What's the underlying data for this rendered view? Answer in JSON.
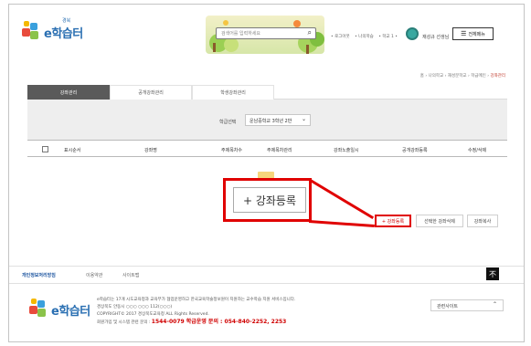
{
  "header": {
    "logo_text": "e학습터",
    "logo_small": "경북",
    "search_placeholder": "검색어를 입력하세요",
    "top_links": [
      "• 로그아웃",
      "• 나의학습",
      "• 학교 1 •"
    ],
    "user_name": "재성규 선생님",
    "all_menu_label": "전체메뉴"
  },
  "breadcrumb": {
    "items": [
      "홈",
      "나의학교",
      "재성분학교",
      "학급메인"
    ],
    "current": "강좌관리"
  },
  "tabs": [
    {
      "label": "강좌관리",
      "active": true
    },
    {
      "label": "공개강좌관리",
      "active": false
    },
    {
      "label": "학생강좌관리",
      "active": false
    }
  ],
  "filter": {
    "label": "학급선택",
    "selected": "운남중학교 3학년 2반"
  },
  "table": {
    "columns": [
      "표시순서",
      "강좌명",
      "주제목차수",
      "주제목차관리",
      "강좌노출일시",
      "공개강좌등록",
      "수정/삭제"
    ]
  },
  "highlight_button_label": "+ 강좌등록",
  "action_buttons": {
    "register": "+ 강좌등록",
    "delete_selected": "선택한 강좌삭제",
    "copy": "강좌복사"
  },
  "footer": {
    "links": [
      "개인정보처리방침",
      "이용약관",
      "사이트맵"
    ],
    "top_button": "不",
    "logo_text": "e학습터",
    "lines": [
      "e학습터는 17개 시도교육청과 교육부가 협업운영하고 한국교육학술정보원이 지원하는 교수학습 지원 서비스입니다.",
      "경상북도 안동시 ○○○ ○○○ 112(○○○)",
      "COPYRIGHT© 2017 경상북도교육청 ALL Rights Reserved."
    ],
    "contact_prefix": "회원가입 및 시스템 관련 문의 : ",
    "contact_1": "1544-0079 학급운영 문의 : ",
    "contact_2": "054-840-2252, 2253",
    "related_label": "관련사이트"
  },
  "colors": {
    "accent_red": "#e00000",
    "tab_active": "#5a5a5a",
    "brand_blue": "#2a6fb2"
  }
}
